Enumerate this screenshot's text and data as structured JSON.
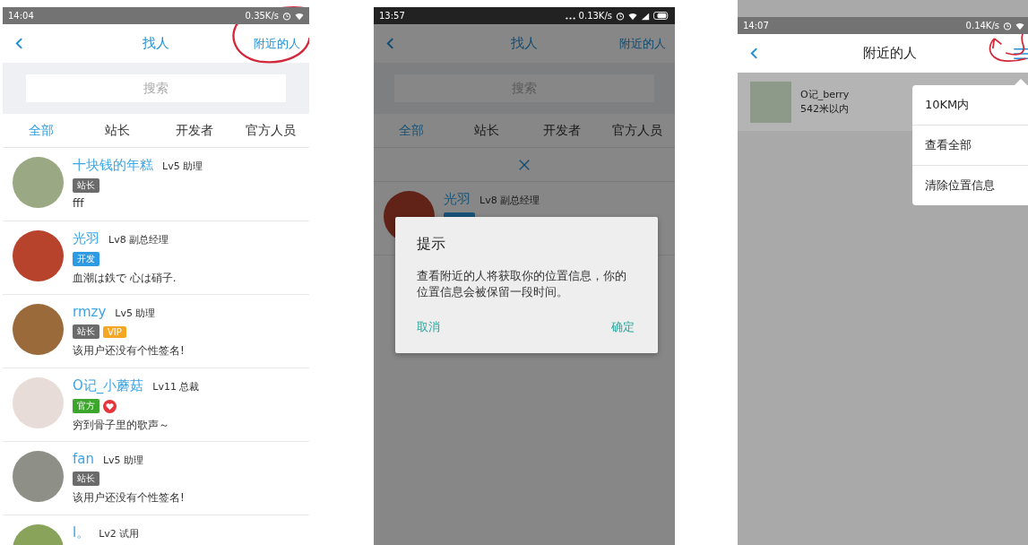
{
  "find_people_screen": {
    "status_bar": {
      "time": "14:04",
      "speed": "0.35K/s"
    },
    "header": {
      "title": "找人",
      "action": "附近的人"
    },
    "search": {
      "placeholder": "搜索"
    },
    "tabs": [
      {
        "label": "全部",
        "selected": true
      },
      {
        "label": "站长",
        "selected": false
      },
      {
        "label": "开发者",
        "selected": false
      },
      {
        "label": "官方人员",
        "selected": false
      }
    ],
    "users": [
      {
        "name": "十块钱的年糕",
        "level": "Lv5 助理",
        "badges": [
          {
            "kind": "tag",
            "text": "站长",
            "color": "#6b6b6b"
          }
        ],
        "signature": "fff"
      },
      {
        "name": "光羽",
        "level": "Lv8 副总经理",
        "badges": [
          {
            "kind": "tag",
            "text": "开发",
            "color": "#2d9be3"
          }
        ],
        "signature": "血潮は鉄で 心は硝子."
      },
      {
        "name": "rmzy",
        "level": "Lv5 助理",
        "badges": [
          {
            "kind": "tag",
            "text": "站长",
            "color": "#6b6b6b"
          },
          {
            "kind": "tag",
            "text": "VIP",
            "color": "#f5a623"
          }
        ],
        "signature": "该用户还没有个性签名!"
      },
      {
        "name": "O记_小蘑菇",
        "level": "Lv11 总裁",
        "badges": [
          {
            "kind": "tag",
            "text": "官方",
            "color": "#3ba52c"
          },
          {
            "kind": "heart",
            "color": "#e5343a"
          }
        ],
        "signature": "穷到骨子里的歌声～"
      },
      {
        "name": "fan",
        "level": "Lv5 助理",
        "badges": [
          {
            "kind": "tag",
            "text": "站长",
            "color": "#6b6b6b"
          }
        ],
        "signature": "该用户还没有个性签名!"
      },
      {
        "name": "l。",
        "level": "Lv2 试用"
      }
    ]
  },
  "dialog_screen": {
    "status_bar": {
      "time": "13:57",
      "speed": "0.13K/s"
    },
    "header": {
      "title": "找人",
      "action": "附近的人"
    },
    "search": {
      "placeholder": "搜索"
    },
    "tabs": [
      {
        "label": "全部",
        "selected": true
      },
      {
        "label": "站长",
        "selected": false
      },
      {
        "label": "开发者",
        "selected": false
      },
      {
        "label": "官方人员",
        "selected": false
      }
    ],
    "users": [
      {
        "name": "光羽",
        "level": "Lv8 副总经理"
      }
    ],
    "dialog": {
      "title": "提示",
      "message": "查看附近的人将获取你的位置信息，你的位置信息会被保留一段时间。",
      "buttons": [
        "取消",
        "确定"
      ]
    }
  },
  "nearby_screen": {
    "status_bar": {
      "time": "14:07",
      "speed": "0.14K/s"
    },
    "header": {
      "title": "附近的人"
    },
    "users": [
      {
        "name": "O记_berry",
        "distance": "542米以内"
      }
    ],
    "menu": [
      "10KM内",
      "查看全部",
      "清除位置信息"
    ]
  }
}
